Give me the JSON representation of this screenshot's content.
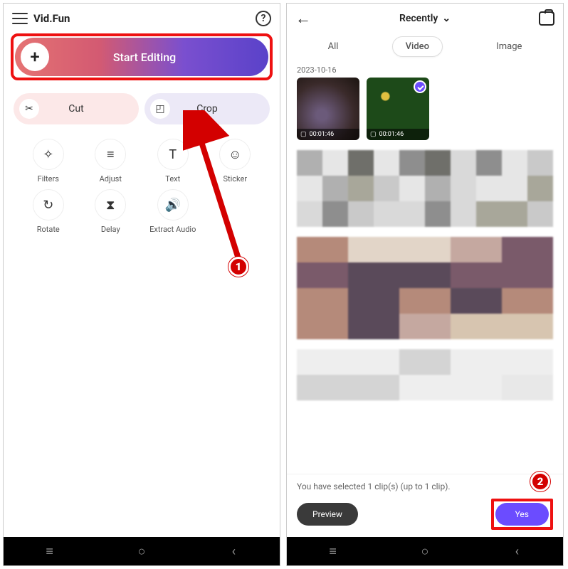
{
  "screen1": {
    "app_title": "Vid.Fun",
    "start_label": "Start Editing",
    "pills": {
      "cut": "Cut",
      "crop": "Crop"
    },
    "tools": [
      {
        "icon": "✧",
        "label": "Filters"
      },
      {
        "icon": "≡",
        "label": "Adjust"
      },
      {
        "icon": "T",
        "label": "Text"
      },
      {
        "icon": "☺",
        "label": "Sticker"
      },
      {
        "icon": "↻",
        "label": "Rotate"
      },
      {
        "icon": "⧗",
        "label": "Delay"
      },
      {
        "icon": "🔊",
        "label": "Extract Audio"
      }
    ],
    "annotation_number": "1"
  },
  "screen2": {
    "dropdown_label": "Recently",
    "tabs": {
      "all": "All",
      "video": "Video",
      "image": "Image"
    },
    "date": "2023-10-16",
    "thumbs": [
      {
        "duration": "00:01:46",
        "selected": false
      },
      {
        "duration": "00:01:46",
        "selected": true
      }
    ],
    "selection_text": "You have selected 1 clip(s) (up to 1 clip).",
    "preview_label": "Preview",
    "yes_label": "Yes",
    "annotation_number": "2"
  }
}
